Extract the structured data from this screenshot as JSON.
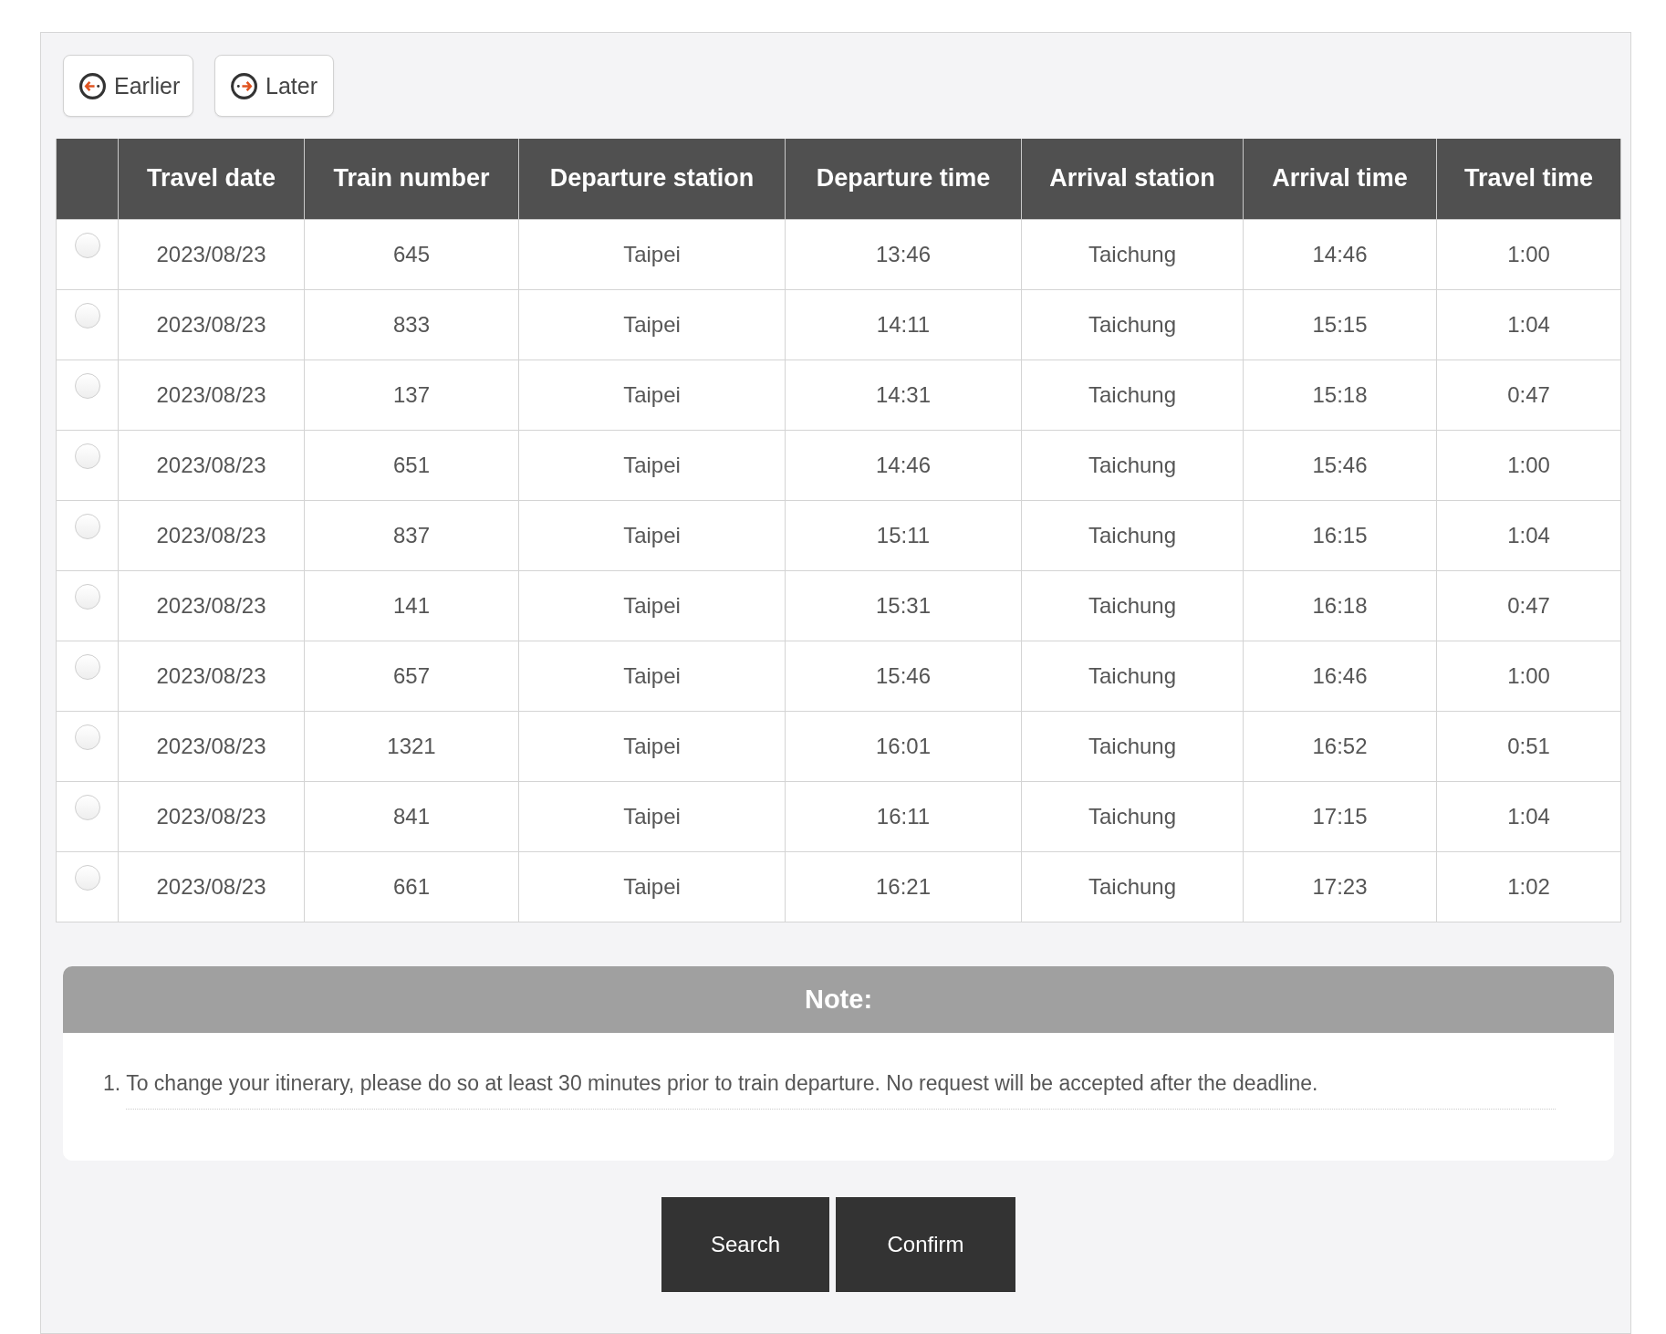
{
  "nav_buttons": [
    {
      "kind": "earlier",
      "label": "Earlier"
    },
    {
      "kind": "later",
      "label": "Later"
    }
  ],
  "table": {
    "columns": [
      "Travel date",
      "Train number",
      "Departure station",
      "Departure time",
      "Arrival station",
      "Arrival time",
      "Travel time"
    ],
    "rows": [
      {
        "selected": false,
        "cells": [
          "2023/08/23",
          "645",
          "Taipei",
          "13:46",
          "Taichung",
          "14:46",
          "1:00"
        ]
      },
      {
        "selected": false,
        "cells": [
          "2023/08/23",
          "833",
          "Taipei",
          "14:11",
          "Taichung",
          "15:15",
          "1:04"
        ]
      },
      {
        "selected": false,
        "cells": [
          "2023/08/23",
          "137",
          "Taipei",
          "14:31",
          "Taichung",
          "15:18",
          "0:47"
        ]
      },
      {
        "selected": false,
        "cells": [
          "2023/08/23",
          "651",
          "Taipei",
          "14:46",
          "Taichung",
          "15:46",
          "1:00"
        ]
      },
      {
        "selected": false,
        "cells": [
          "2023/08/23",
          "837",
          "Taipei",
          "15:11",
          "Taichung",
          "16:15",
          "1:04"
        ]
      },
      {
        "selected": false,
        "cells": [
          "2023/08/23",
          "141",
          "Taipei",
          "15:31",
          "Taichung",
          "16:18",
          "0:47"
        ]
      },
      {
        "selected": false,
        "cells": [
          "2023/08/23",
          "657",
          "Taipei",
          "15:46",
          "Taichung",
          "16:46",
          "1:00"
        ]
      },
      {
        "selected": false,
        "cells": [
          "2023/08/23",
          "1321",
          "Taipei",
          "16:01",
          "Taichung",
          "16:52",
          "0:51"
        ]
      },
      {
        "selected": false,
        "cells": [
          "2023/08/23",
          "841",
          "Taipei",
          "16:11",
          "Taichung",
          "17:15",
          "1:04"
        ]
      },
      {
        "selected": false,
        "cells": [
          "2023/08/23",
          "661",
          "Taipei",
          "16:21",
          "Taichung",
          "17:23",
          "1:02"
        ]
      }
    ]
  },
  "note": {
    "title": "Note:",
    "items": [
      {
        "number": "1.",
        "text": "To change your itinerary, please do so at least 30 minutes prior to train departure. No request will be accepted after the deadline."
      }
    ]
  },
  "actions": [
    "Search",
    "Confirm"
  ]
}
